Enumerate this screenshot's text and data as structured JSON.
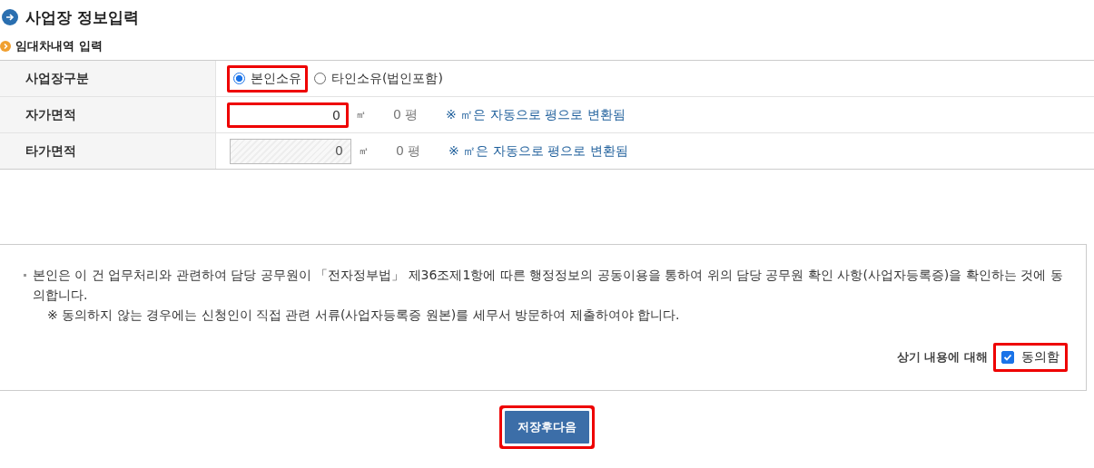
{
  "title": "사업장 정보입력",
  "subtitle": "임대차내역 입력",
  "rows": [
    {
      "kind": "radio",
      "label": "사업장구분",
      "options": [
        {
          "label": "본인소유",
          "selected": true,
          "highlighted": true
        },
        {
          "label": "타인소유(법인포함)",
          "selected": false,
          "highlighted": false
        }
      ]
    },
    {
      "kind": "area",
      "label": "자가면적",
      "value": "0",
      "disabled": false,
      "highlighted": true,
      "unit": "㎡",
      "pyeong": "0 평",
      "note": "※ ㎡은 자동으로 평으로 변환됨"
    },
    {
      "kind": "area",
      "label": "타가면적",
      "value": "0",
      "disabled": true,
      "highlighted": false,
      "unit": "㎡",
      "pyeong": "0 평",
      "note": "※ ㎡은 자동으로 평으로 변환됨"
    }
  ],
  "notice": {
    "lines": [
      "본인은 이 건 업무처리와 관련하여 담당 공무원이 「전자정부법」 제36조제1항에 따른 행정정보의 공동이용을 통하여 위의 담당 공무원 확인 사항(사업자등록증)을 확인하는 것에 동의합니다.",
      "※  동의하지 않는 경우에는 신청인이 직접 관련 서류(사업자등록증 원본)를 세무서 방문하여 제출하여야 합니다."
    ],
    "agree_prompt": "상기 내용에 대해",
    "agree_label": "동의함",
    "checked": true,
    "highlighted": true
  },
  "button": {
    "label": "저장후다음",
    "highlighted": true
  }
}
